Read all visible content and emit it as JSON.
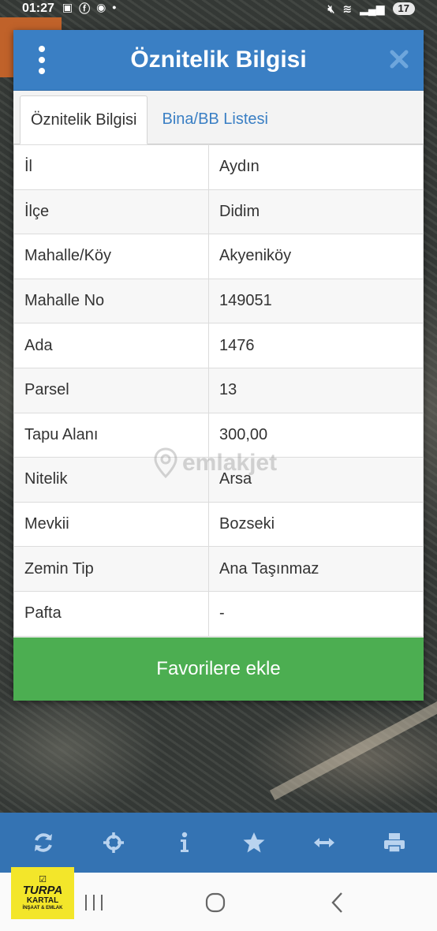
{
  "status_bar": {
    "time": "01:27",
    "battery": "17"
  },
  "dialog": {
    "title": "Öznitelik Bilgisi",
    "tabs": [
      {
        "label": "Öznitelik Bilgisi",
        "active": true
      },
      {
        "label": "Bina/BB Listesi",
        "active": false
      }
    ],
    "rows": [
      {
        "key": "İl",
        "value": "Aydın"
      },
      {
        "key": "İlçe",
        "value": "Didim"
      },
      {
        "key": "Mahalle/Köy",
        "value": "Akyeniköy"
      },
      {
        "key": "Mahalle No",
        "value": "149051"
      },
      {
        "key": "Ada",
        "value": "1476"
      },
      {
        "key": "Parsel",
        "value": "13"
      },
      {
        "key": "Tapu Alanı",
        "value": "300,00"
      },
      {
        "key": "Nitelik",
        "value": "Arsa"
      },
      {
        "key": "Mevkii",
        "value": "Bozseki"
      },
      {
        "key": "Zemin Tip",
        "value": "Ana Taşınmaz"
      },
      {
        "key": "Pafta",
        "value": "-"
      }
    ],
    "favorite_button": "Favorilere ekle"
  },
  "watermark": "emlakjet",
  "toolbar": {
    "icons": [
      "refresh-icon",
      "locate-icon",
      "info-icon",
      "star-icon",
      "measure-icon",
      "print-icon"
    ]
  },
  "logo": {
    "line1": "TURPA",
    "line2": "KARTAL",
    "line3": "İNŞAAT & EMLAK"
  },
  "colors": {
    "header": "#3a7fc4",
    "toolbar": "#3473b3",
    "button": "#4cae51",
    "tab_link": "#3a7fc4"
  }
}
